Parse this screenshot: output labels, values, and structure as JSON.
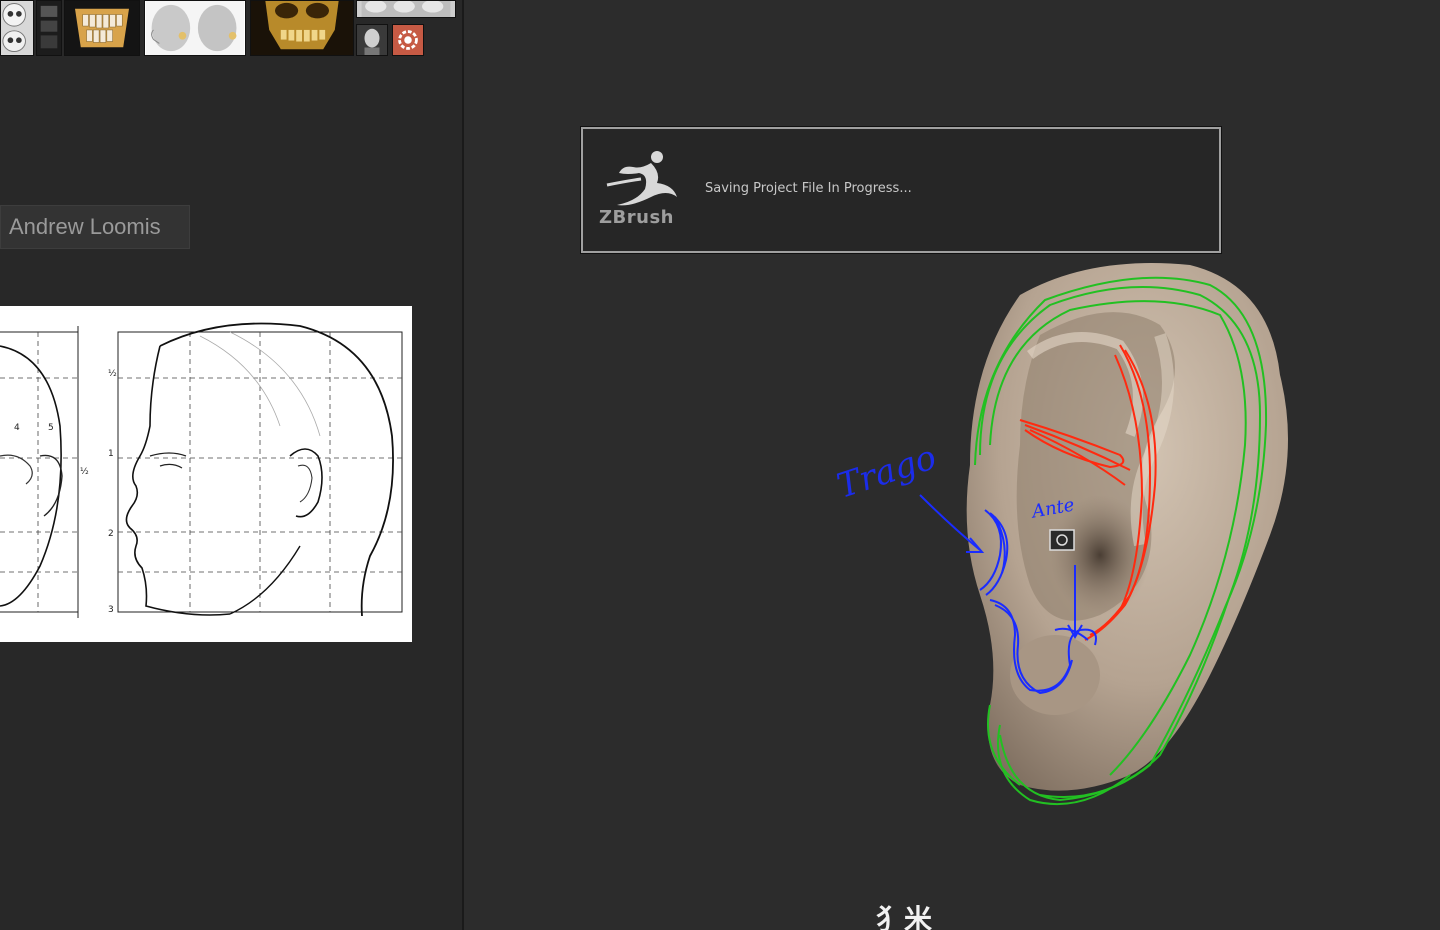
{
  "reference_panel": {
    "label": "Andrew Loomis"
  },
  "dialog": {
    "logo_text": "ZBrush",
    "message": "Saving Project File In Progress..."
  },
  "annotations": {
    "left_note": "Trago",
    "right_note": "Ante"
  },
  "colors": {
    "background": "#2c2c2c",
    "panel": "#282828",
    "dialog_border": "#a0a0a0",
    "stroke_green": "#22c022",
    "stroke_red": "#ff2a10",
    "stroke_blue": "#1a2cff",
    "ear_skin": "#b7a594"
  },
  "icons": {
    "dialog_logo": "zbrush-logo-icon",
    "cursor": "camera-icon"
  }
}
